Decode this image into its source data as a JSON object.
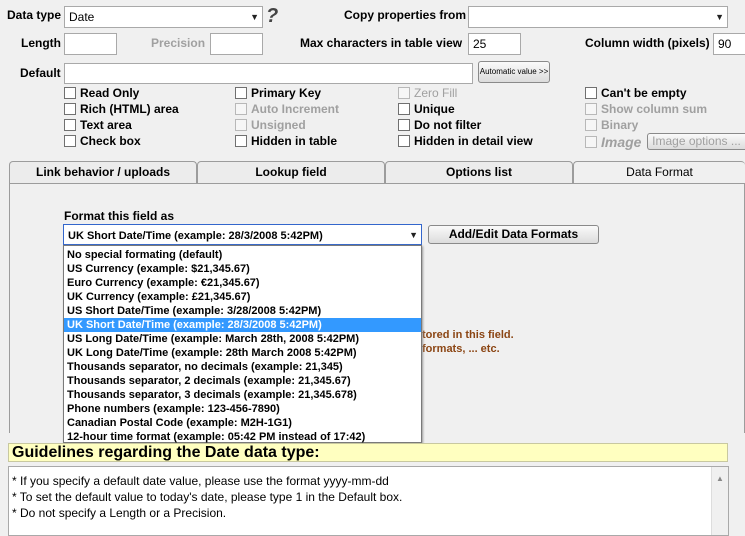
{
  "top": {
    "datatype_label": "Data type",
    "datatype_value": "Date",
    "help_icon": "?",
    "copy_label": "Copy properties from",
    "copy_value": "",
    "length_label": "Length",
    "length_value": "",
    "precision_label": "Precision",
    "precision_value": "",
    "maxchars_label": "Max characters in table view",
    "maxchars_value": "25",
    "colwidth_label": "Column width (pixels)",
    "colwidth_value": "90",
    "default_label": "Default",
    "default_value": "",
    "auto_value_btn": "Automatic value >>"
  },
  "checkboxes": {
    "read_only": "Read Only",
    "rich_html": "Rich (HTML) area",
    "text_area": "Text area",
    "check_box": "Check box",
    "primary_key": "Primary Key",
    "auto_increment": "Auto Increment",
    "unsigned": "Unsigned",
    "hidden_in_table": "Hidden in table",
    "zero_fill": "Zero Fill",
    "unique": "Unique",
    "do_not_filter": "Do not filter",
    "hidden_in_detail": "Hidden in detail view",
    "cant_be_empty": "Can't be empty",
    "show_column_sum": "Show column sum",
    "binary": "Binary",
    "image": "Image",
    "image_options_btn": "Image options ..."
  },
  "tabs": [
    {
      "label": "Link behavior / uploads"
    },
    {
      "label": "Lookup field"
    },
    {
      "label": "Options list"
    },
    {
      "label": "Data Format"
    }
  ],
  "format": {
    "label": "Format this field as",
    "selected": "UK Short Date/Time (example: 28/3/2008 5:42PM)",
    "add_edit_btn": "Add/Edit Data Formats",
    "options": [
      "No special formating (default)",
      "US Currency (example: $21,345.67)",
      "Euro Currency (example: €21,345.67)",
      "UK Currency (example: £21,345.67)",
      "US Short Date/Time (example: 3/28/2008 5:42PM)",
      "UK Short Date/Time (example: 28/3/2008 5:42PM)",
      "US Long Date/Time (example: March 28th, 2008 5:42PM)",
      "UK Long Date/Time (example: 28th March 2008 5:42PM)",
      "Thousands separator, no decimals (example: 21,345)",
      "Thousands separator, 2 decimals (example: 21,345.67)",
      "Thousands separator, 3 decimals (example: 21,345.678)",
      "Phone numbers (example: 123-456-7890)",
      "Canadian Postal Code (example: M2H-1G1)",
      "12-hour time format (example: 05:42 PM instead of 17:42)"
    ],
    "selected_index": 5,
    "hint_line1": "tored in this field.",
    "hint_line2": "formats, ... etc."
  },
  "guidelines": {
    "title": "Guidelines regarding the Date data type:",
    "lines": [
      "* If you specify a default date value, please use the format yyyy-mm-dd",
      "* To set the default value to today's date, please type 1 in the Default box.",
      "* Do not specify a Length or a Precision."
    ]
  }
}
